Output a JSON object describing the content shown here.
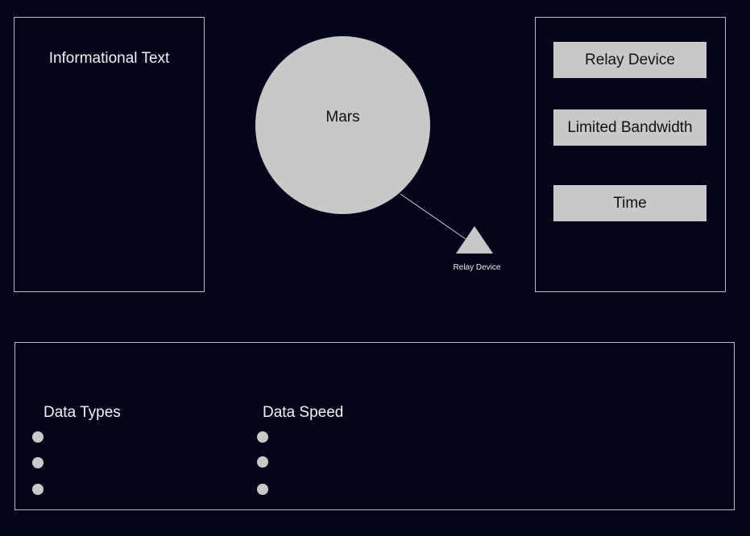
{
  "info_panel": {
    "title": "Informational Text"
  },
  "planet": {
    "label": "Mars"
  },
  "relay": {
    "caption": "Relay Device",
    "icon": "triangle-icon"
  },
  "controls": [
    {
      "label": "Relay Device"
    },
    {
      "label": "Limited Bandwidth"
    },
    {
      "label": "Time"
    }
  ],
  "bottom": {
    "data_types": {
      "title": "Data Types",
      "items": [
        "",
        "",
        ""
      ]
    },
    "data_speed": {
      "title": "Data Speed",
      "items": [
        "",
        "",
        ""
      ]
    }
  },
  "colors": {
    "background": "#03041a",
    "panel_border": "#b9bcc6",
    "shape_fill": "#c8c8c8"
  }
}
